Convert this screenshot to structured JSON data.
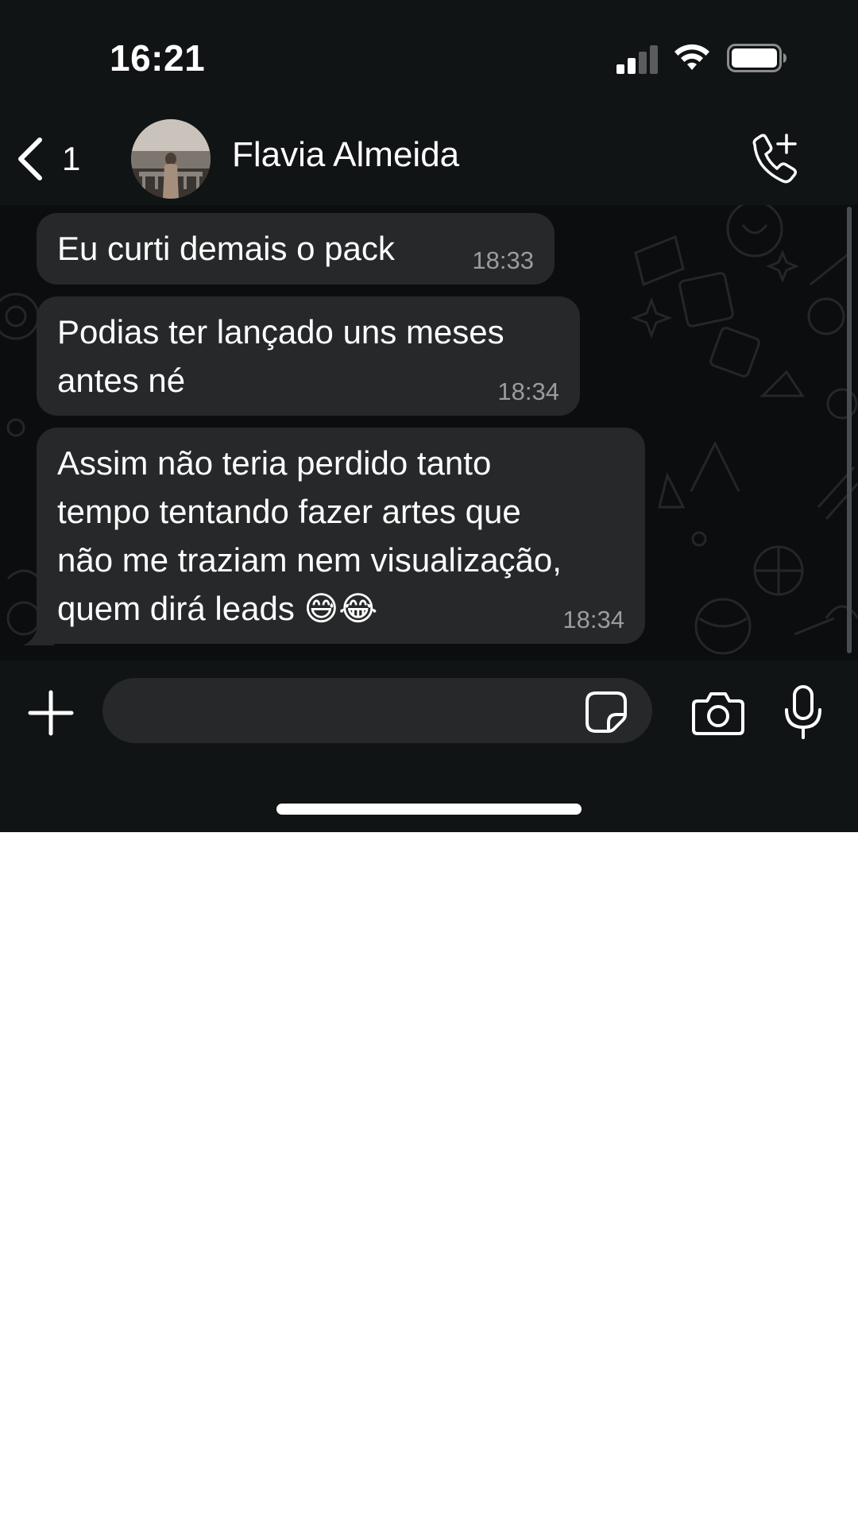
{
  "status_bar": {
    "time": "16:21",
    "icons": [
      "cellular-signal-icon",
      "wifi-icon",
      "battery-icon"
    ]
  },
  "header": {
    "back_count": "1",
    "contact_name": "Flavia Almeida",
    "icons": [
      "back-chevron-icon",
      "add-call-icon"
    ]
  },
  "messages": [
    {
      "text": "Eu curti demais o pack",
      "time": "18:33"
    },
    {
      "text": "Podias ter lançado uns meses\nantes né",
      "time": "18:34"
    },
    {
      "text": "Assim não teria perdido tanto\ntempo tentando fazer artes que\nnão me traziam nem visualização,\nquem dirá leads 😅😂",
      "time": "18:34"
    }
  ],
  "input_bar": {
    "value": "",
    "placeholder": "",
    "icons": [
      "plus-icon",
      "sticker-icon",
      "camera-icon",
      "microphone-icon"
    ]
  },
  "colors": {
    "background": "#111415",
    "chat_wallpaper": "#0b0d0e",
    "bubble": "#262829",
    "timestamp": "#9a9c9e",
    "text": "#ffffff"
  }
}
